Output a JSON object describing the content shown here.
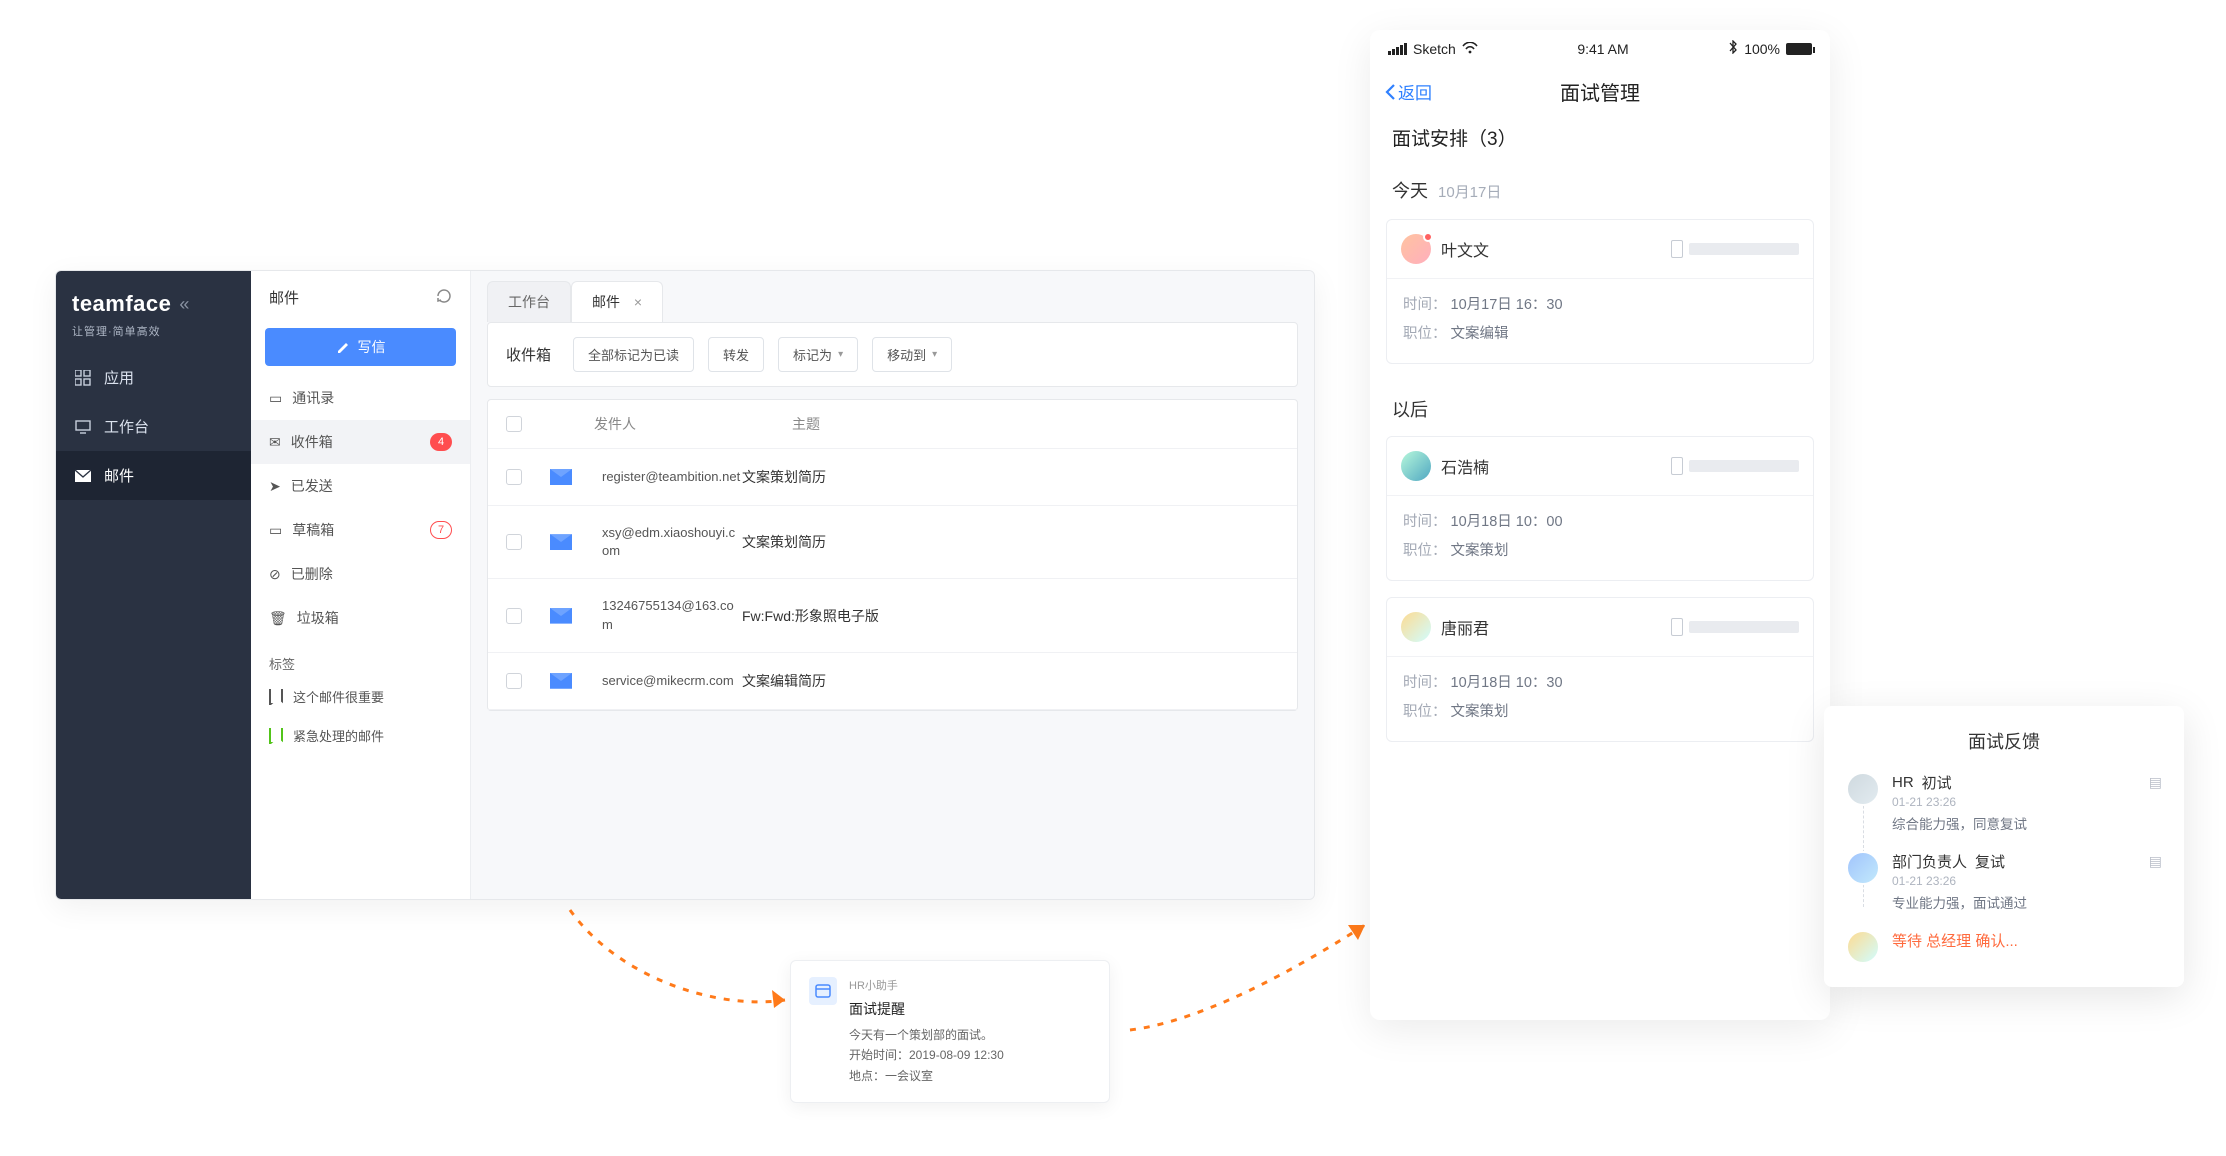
{
  "desktop": {
    "brand_name": "teamface",
    "brand_tag": "让管理·简单高效",
    "nav": {
      "apps": "应用",
      "workbench": "工作台",
      "mail": "邮件"
    },
    "side": {
      "title": "邮件",
      "compose": "写信",
      "contacts": "通讯录",
      "inbox": "收件箱",
      "inbox_badge": "4",
      "sent": "已发送",
      "drafts": "草稿箱",
      "drafts_badge": "7",
      "deleted": "已删除",
      "trash": "垃圾箱",
      "tags_label": "标签",
      "tag1": "这个邮件很重要",
      "tag2": "紧急处理的邮件"
    },
    "tabs": {
      "workbench": "工作台",
      "mail": "邮件"
    },
    "toolbar": {
      "title": "收件箱",
      "mark_all": "全部标记为已读",
      "forward": "转发",
      "mark_as": "标记为",
      "move_to": "移动到"
    },
    "cols": {
      "sender": "发件人",
      "subject": "主题"
    },
    "rows": [
      {
        "sender": "register@teambition.net",
        "subject": "文案策划简历"
      },
      {
        "sender": "xsy@edm.xiaoshouyi.com",
        "subject": "文案策划简历"
      },
      {
        "sender": "13246755134@163.com",
        "subject": "Fw:Fwd:形象照电子版"
      },
      {
        "sender": "service@mikecrm.com",
        "subject": "文案编辑简历"
      }
    ]
  },
  "notif": {
    "app": "HR小助手",
    "title": "面试提醒",
    "line1": "今天有一个策划部的面试。",
    "line2": "开始时间：2019-08-09 12:30",
    "line3": "地点：一会议室"
  },
  "phone": {
    "status": {
      "carrier": "Sketch",
      "time": "9:41 AM",
      "batt": "100%"
    },
    "back": "返回",
    "title": "面试管理",
    "section": "面试安排（3）",
    "today_label": "今天",
    "today_date": "10月17日",
    "later_label": "以后",
    "labels": {
      "time": "时间：",
      "position": "职位："
    },
    "cards": [
      {
        "name": "叶文文",
        "time": "10月17日 16：30",
        "position": "文案编辑",
        "has_dot": true
      },
      {
        "name": "石浩楠",
        "time": "10月18日 10：00",
        "position": "文案策划",
        "has_dot": false
      },
      {
        "name": "唐丽君",
        "time": "10月18日 10：30",
        "position": "文案策划",
        "has_dot": false
      }
    ]
  },
  "feedback": {
    "title": "面试反馈",
    "items": [
      {
        "role": "HR",
        "stage": "初试",
        "time": "01-21 23:26",
        "text": "综合能力强，同意复试"
      },
      {
        "role": "部门负责人",
        "stage": "复试",
        "time": "01-21 23:26",
        "text": "专业能力强，面试通过"
      }
    ],
    "waiting": "等待 总经理 确认..."
  }
}
